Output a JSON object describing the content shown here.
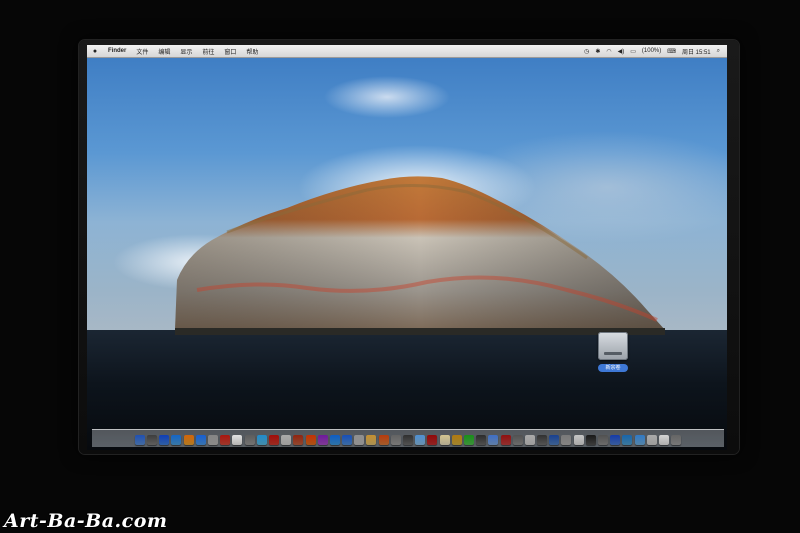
{
  "menubar": {
    "apple_icon": "apple-icon",
    "items": [
      "Finder",
      "文件",
      "编辑",
      "显示",
      "前往",
      "窗口",
      "帮助"
    ],
    "status": {
      "battery": "(100%)",
      "clock": "周日 15:51"
    }
  },
  "desktop": {
    "drive_label": "新宗卷"
  },
  "dock": {
    "icon_colors": [
      "#5a8fd6",
      "#7d7d7d",
      "#3f7ed8",
      "#4aa0e0",
      "#e8a130",
      "#4c9be8",
      "#b8b8b8",
      "#d14b3c",
      "#f0f0f0",
      "#9a9a9a",
      "#5bbce4",
      "#cc3b2f",
      "#d0d0d0",
      "#c06040",
      "#e07020",
      "#a84fc8",
      "#3d9ae0",
      "#4e8ed8",
      "#bfbfbf",
      "#e0c070",
      "#d87b3a",
      "#9f9f9f",
      "#6e6e6e",
      "#8dc0e8",
      "#c03030",
      "#e8e0c0",
      "#d4b040",
      "#50c050",
      "#6a6a6a",
      "#7fa8e0",
      "#c04040",
      "#909090",
      "#d0d0d0",
      "#707070",
      "#5080c0",
      "#b0b0b0",
      "#e0e0e0",
      "#505050",
      "#909090",
      "#4a7bd0",
      "#50a0d0",
      "#70b0e0",
      "#d0d0d0",
      "#e8e8e8",
      "#a0a0a0"
    ]
  },
  "watermark": {
    "text": "Art-Ba-Ba.com"
  }
}
